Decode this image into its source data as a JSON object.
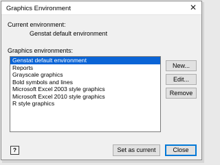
{
  "window": {
    "title": "Graphics Environment"
  },
  "current": {
    "label": "Current environment:",
    "value": "Genstat default environment"
  },
  "environments": {
    "label": "Graphics environments:",
    "items": [
      "Genstat default environment",
      "Reports",
      "Grayscale graphics",
      "Bold symbols and lines",
      "Microsoft Excel 2003 style graphics",
      "Microsoft Excel 2010 style graphics",
      "R style graphics"
    ],
    "selected_index": 0
  },
  "buttons": {
    "new": "New...",
    "edit": "Edit...",
    "remove": "Remove",
    "help": "?",
    "set_current": "Set as current",
    "close": "Close"
  },
  "colors": {
    "selection": "#0a64d6",
    "default_button_border": "#0078d7"
  }
}
